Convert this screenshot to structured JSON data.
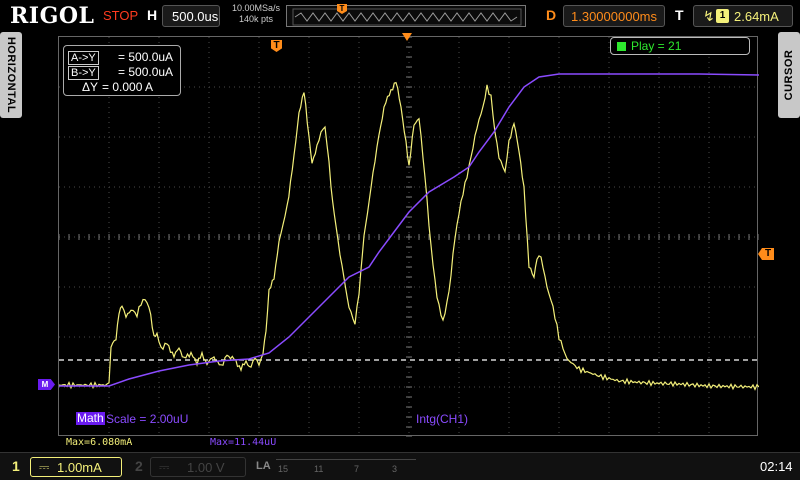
{
  "topbar": {
    "brand": "RIGOL",
    "run_state": "STOP",
    "h_label": "H",
    "h_scale": "500.0us",
    "sample_rate": "10.00MSa/s",
    "mem_depth": "140k pts",
    "trigger_marker": "T",
    "delay_label": "D",
    "delay_value": "1.30000000ms",
    "trigger_label": "T",
    "trigger_source": "1",
    "trigger_level": "2.64mA",
    "trigger_slope_icon": "rising-edge-icon"
  },
  "side_tabs": {
    "left": "HORIZONTAL",
    "right": "CURSOR"
  },
  "cursor_readout": {
    "a_label": "A->Y",
    "a_value": "= 500.0uA",
    "b_label": "B->Y",
    "b_value": "= 500.0uA",
    "delta_label": "ΔY",
    "delta_value": "= 0.000 A"
  },
  "play": "Play = 21",
  "math": {
    "tag": "Math",
    "scale": "Scale = 2.00uU",
    "source": "Intg(CH1)",
    "ch_marker": "M"
  },
  "markers": {
    "trigger_top": "T",
    "trigger_right": "T"
  },
  "measurements": {
    "ch1_max": "Max=6.080mA",
    "math_max": "Max=11.44uU"
  },
  "channels": {
    "ch1_number": "1",
    "ch1_coupling_icon": "dc-coupling-icon",
    "ch1_scale": "1.00mA",
    "ch2_number": "2",
    "ch2_scale": "1.00 V",
    "la_label": "LA",
    "la_ticks": [
      "15",
      "11",
      "7",
      "3"
    ]
  },
  "clock": "02:14",
  "colors": {
    "ch1": "#f4f07a",
    "math": "#8a4bff",
    "trigger": "#ff8c1a",
    "stop": "#ff3b1f",
    "play": "#2ee82e"
  }
}
